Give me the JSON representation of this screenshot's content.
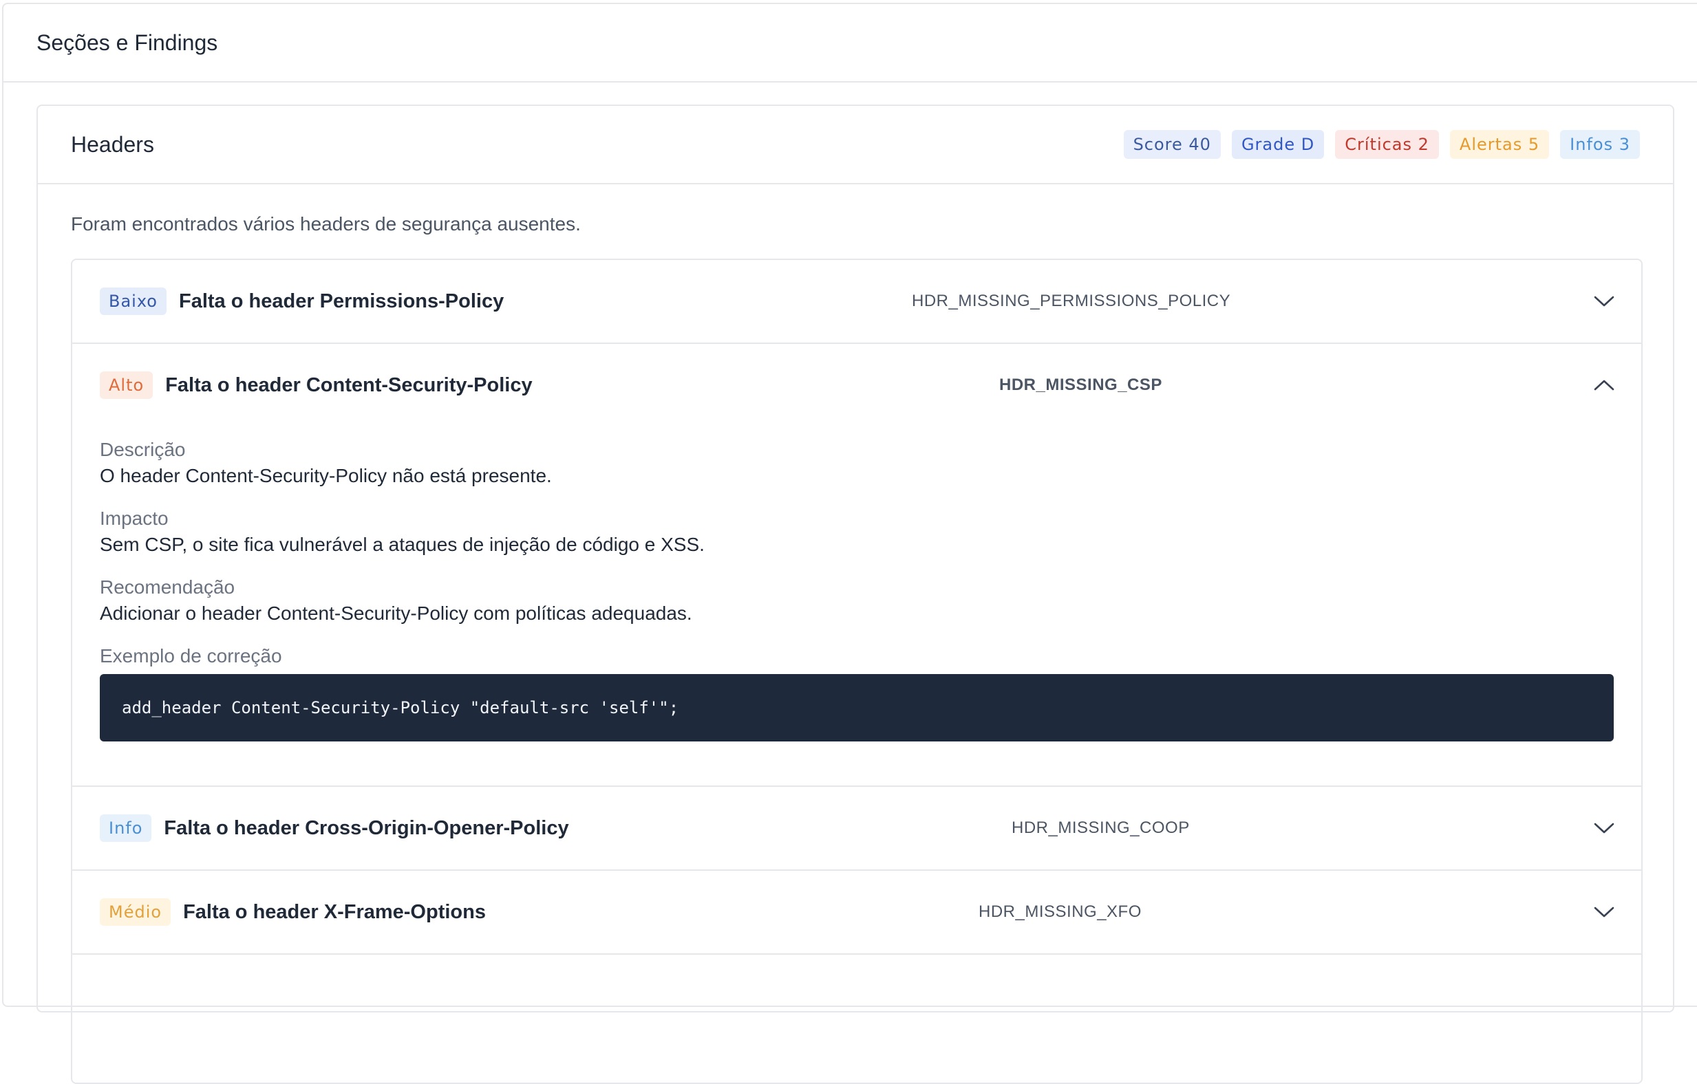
{
  "page": {
    "title": "Seções e Findings"
  },
  "section": {
    "title": "Headers",
    "badges": {
      "score": "Score 40",
      "grade": "Grade D",
      "criticas": "Críticas 2",
      "alertas": "Alertas 5",
      "infos": "Infos 3"
    },
    "summary": "Foram encontrados vários headers de segurança ausentes."
  },
  "findings": [
    {
      "severity": "Baixo",
      "title": "Falta o header Permissions-Policy",
      "code": "HDR_MISSING_PERMISSIONS_POLICY",
      "expanded": false
    },
    {
      "severity": "Alto",
      "title": "Falta o header Content-Security-Policy",
      "code": "HDR_MISSING_CSP",
      "expanded": true,
      "labels": {
        "description": "Descrição",
        "impact": "Impacto",
        "recommendation": "Recomendação",
        "example": "Exemplo de correção"
      },
      "description": "O header Content-Security-Policy não está presente.",
      "impact": "Sem CSP, o site fica vulnerável a ataques de injeção de código e XSS.",
      "recommendation": "Adicionar o header Content-Security-Policy com políticas adequadas.",
      "example": "add_header Content-Security-Policy \"default-src 'self'\";"
    },
    {
      "severity": "Info",
      "title": "Falta o header Cross-Origin-Opener-Policy",
      "code": "HDR_MISSING_COOP",
      "expanded": false
    },
    {
      "severity": "Médio",
      "title": "Falta o header X-Frame-Options",
      "code": "HDR_MISSING_XFO",
      "expanded": false
    }
  ],
  "colors": {
    "code_bg": "#1e293b",
    "border": "#e5e7eb"
  },
  "icons": {
    "collapsed": "chevron-down-icon",
    "expanded": "chevron-up-icon"
  }
}
